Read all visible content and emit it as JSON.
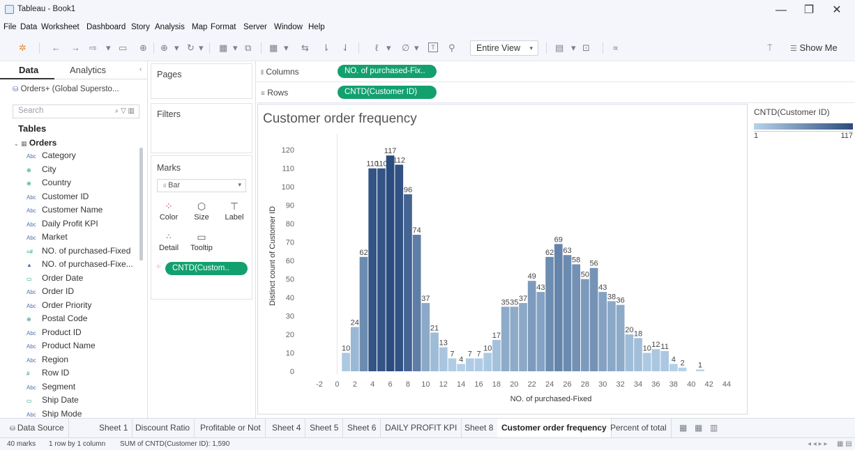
{
  "window": {
    "title": "Tableau - Book1",
    "minimize": "—",
    "restore": "❐",
    "close": "✕"
  },
  "menu": [
    "File",
    "Data",
    "Worksheet",
    "Dashboard",
    "Story",
    "Analysis",
    "Map",
    "Format",
    "Server",
    "Window",
    "Help"
  ],
  "toolbar": {
    "fit": "Entire View",
    "show_me": "Show Me"
  },
  "left_panel": {
    "tab_data": "Data",
    "tab_analytics": "Analytics",
    "datasource": "Orders+ (Global Supersto...",
    "search_placeholder": "Search",
    "tables_label": "Tables",
    "table_name": "Orders",
    "fields": [
      {
        "label": "Category",
        "icon": "Abc"
      },
      {
        "label": "City",
        "icon": "⊕"
      },
      {
        "label": "Country",
        "icon": "⊕"
      },
      {
        "label": "Customer ID",
        "icon": "Abc"
      },
      {
        "label": "Customer Name",
        "icon": "Abc"
      },
      {
        "label": "Daily Profit KPI",
        "icon": "Abc"
      },
      {
        "label": "Market",
        "icon": "Abc"
      },
      {
        "label": "NO. of purchased-Fixed",
        "icon": "=#"
      },
      {
        "label": "NO. of purchased-Fixe...",
        "icon": "▲"
      },
      {
        "label": "Order Date",
        "icon": "▭"
      },
      {
        "label": "Order ID",
        "icon": "Abc"
      },
      {
        "label": "Order Priority",
        "icon": "Abc"
      },
      {
        "label": "Postal Code",
        "icon": "⊕"
      },
      {
        "label": "Product ID",
        "icon": "Abc"
      },
      {
        "label": "Product Name",
        "icon": "Abc"
      },
      {
        "label": "Region",
        "icon": "Abc"
      },
      {
        "label": "Row ID",
        "icon": "#"
      },
      {
        "label": "Segment",
        "icon": "Abc"
      },
      {
        "label": "Ship Date",
        "icon": "▭"
      },
      {
        "label": "Ship Mode",
        "icon": "Abc"
      }
    ]
  },
  "shelves": {
    "pages": "Pages",
    "filters": "Filters",
    "marks": "Marks",
    "mark_type": "Bar",
    "mark_buttons": [
      "Color",
      "Size",
      "Label",
      "Detail",
      "Tooltip"
    ],
    "marks_pill": "CNTD(Custom..",
    "columns_label": "Columns",
    "columns_pill": "NO. of purchased-Fix..",
    "rows_label": "Rows",
    "rows_pill": "CNTD(Customer ID)"
  },
  "legend": {
    "title": "CNTD(Customer ID)",
    "min": "1",
    "max": "117",
    "color_low": "#b7d3ea",
    "color_high": "#2b4c7e"
  },
  "chart_data": {
    "type": "bar",
    "title": "Customer order frequency",
    "xlabel": "NO. of purchased-Fixed",
    "ylabel": "Distinct count of Customer ID",
    "xlim": [
      -2,
      44
    ],
    "ylim": [
      0,
      125
    ],
    "x_ticks": [
      -2,
      0,
      2,
      4,
      6,
      8,
      10,
      12,
      14,
      16,
      18,
      20,
      22,
      24,
      26,
      28,
      30,
      32,
      34,
      36,
      38,
      40,
      42,
      44
    ],
    "y_ticks": [
      0,
      10,
      20,
      30,
      40,
      50,
      60,
      70,
      80,
      90,
      100,
      110,
      120
    ],
    "x": [
      1,
      2,
      3,
      4,
      5,
      6,
      7,
      8,
      9,
      10,
      11,
      12,
      13,
      14,
      15,
      16,
      17,
      18,
      19,
      20,
      21,
      22,
      23,
      24,
      25,
      26,
      27,
      28,
      29,
      30,
      31,
      32,
      33,
      34,
      35,
      36,
      37,
      38,
      39,
      41
    ],
    "values": [
      10,
      24,
      62,
      110,
      110,
      117,
      112,
      96,
      74,
      37,
      21,
      13,
      7,
      4,
      7,
      7,
      10,
      17,
      35,
      35,
      37,
      49,
      43,
      62,
      69,
      63,
      58,
      50,
      56,
      43,
      38,
      36,
      20,
      18,
      10,
      12,
      11,
      4,
      2,
      1
    ],
    "color_low": "#b7d3ea",
    "color_high": "#2b4c7e"
  },
  "sheets": [
    "Data Source",
    "Sheet 1",
    "Discount Ratio",
    "Profitable or Not",
    "Sheet 4",
    "Sheet 5",
    "Sheet 6",
    "DAILY PROFIT KPI",
    "Sheet 8",
    "Customer order frequency",
    "Percent of total"
  ],
  "active_sheet": "Customer order frequency",
  "status": {
    "marks": "40 marks",
    "grid": "1 row by 1 column",
    "sum": "SUM of CNTD(Customer ID): 1,590"
  }
}
